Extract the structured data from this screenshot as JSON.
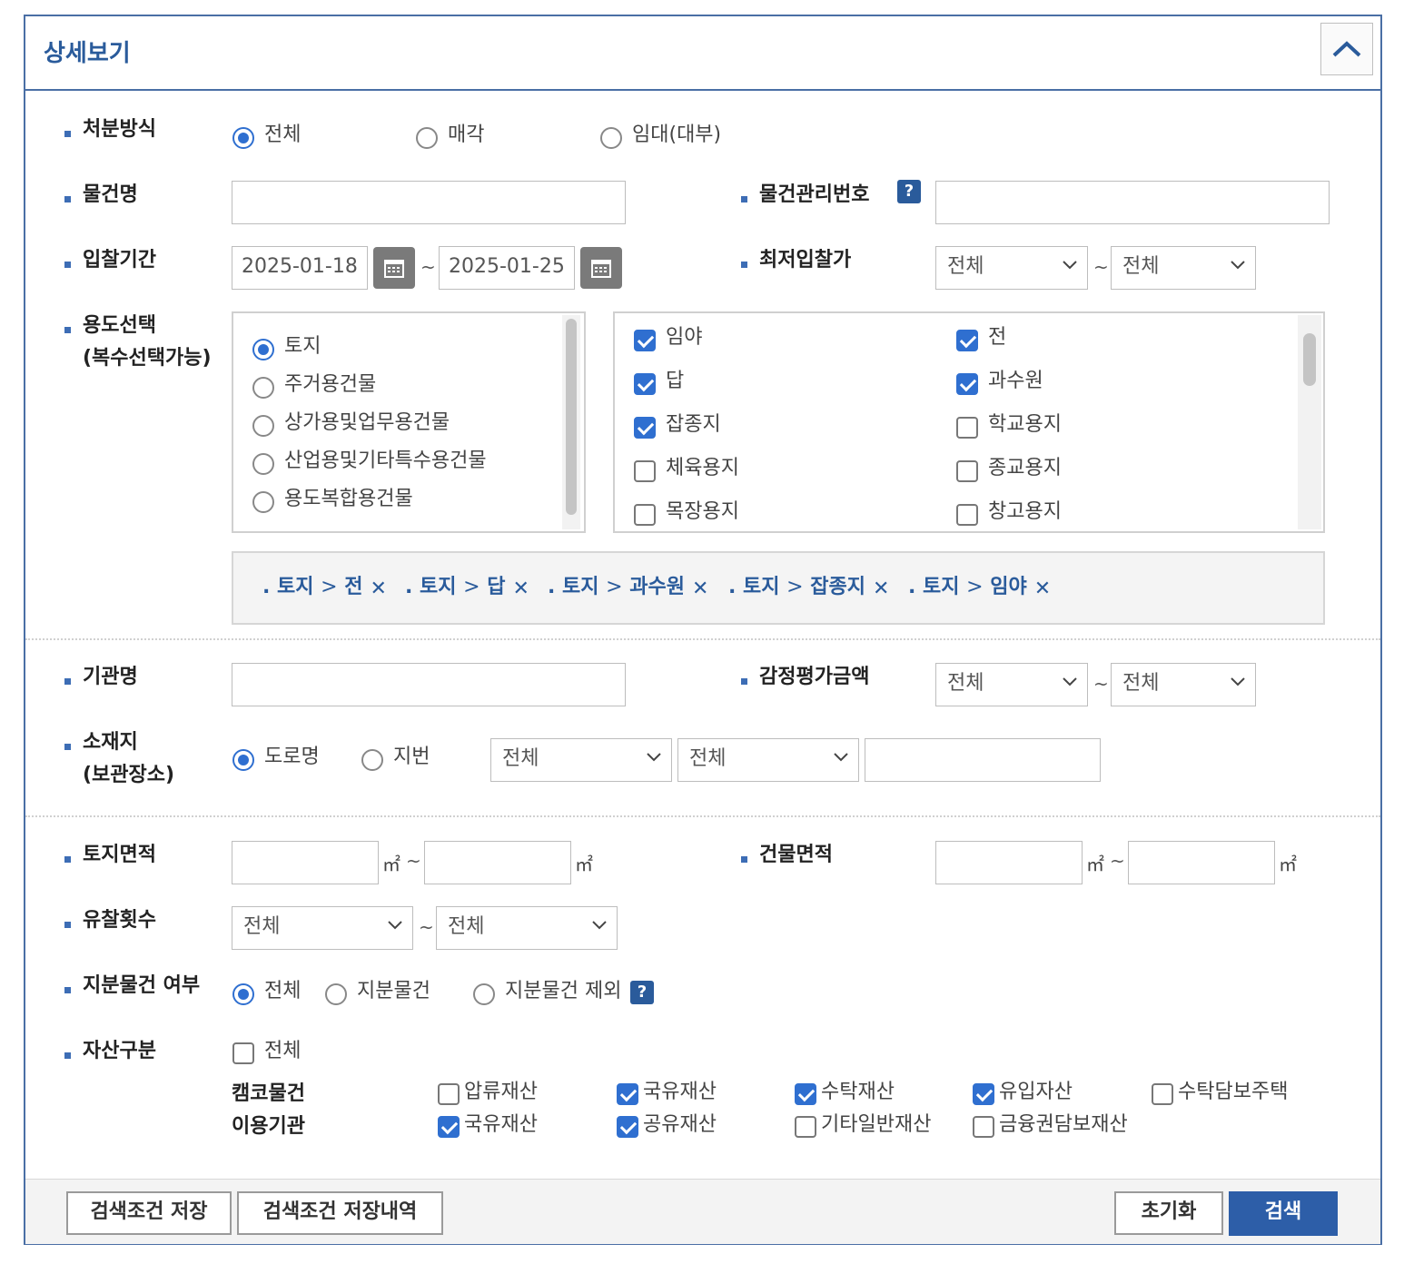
{
  "header": {
    "title": "상세보기",
    "collapse_icon": "chevron-up-icon"
  },
  "disposal": {
    "label": "처분방식",
    "options": [
      "전체",
      "매각",
      "임대(대부)"
    ],
    "selected": "전체"
  },
  "item_name": {
    "label": "물건명",
    "value": ""
  },
  "item_mgmt_no": {
    "label": "물건관리번호",
    "help": "?",
    "value": ""
  },
  "bid_period": {
    "label": "입찰기간",
    "start": "2025-01-18",
    "end": "2025-01-25",
    "tilde": "~"
  },
  "min_bid_price": {
    "label": "최저입찰가",
    "from": "전체",
    "to": "전체",
    "tilde": "~"
  },
  "usage": {
    "label_line1": "용도선택",
    "label_line2": "(복수선택가능)",
    "categories": [
      "토지",
      "주거용건물",
      "상가용및업무용건물",
      "산업용및기타특수용건물",
      "용도복합용건물"
    ],
    "selected_category": "토지",
    "subtypes": [
      {
        "name": "임야",
        "checked": true
      },
      {
        "name": "전",
        "checked": true
      },
      {
        "name": "답",
        "checked": true
      },
      {
        "name": "과수원",
        "checked": true
      },
      {
        "name": "잡종지",
        "checked": true
      },
      {
        "name": "학교용지",
        "checked": false
      },
      {
        "name": "체육용지",
        "checked": false
      },
      {
        "name": "종교용지",
        "checked": false
      },
      {
        "name": "목장용지",
        "checked": false
      },
      {
        "name": "창고용지",
        "checked": false
      }
    ],
    "tags": [
      {
        "prefix": ". 토지",
        "sep": ">",
        "item": "전"
      },
      {
        "prefix": ". 토지",
        "sep": ">",
        "item": "답"
      },
      {
        "prefix": ". 토지",
        "sep": ">",
        "item": "과수원"
      },
      {
        "prefix": ". 토지",
        "sep": ">",
        "item": "잡종지"
      },
      {
        "prefix": ". 토지",
        "sep": ">",
        "item": "임야"
      }
    ]
  },
  "agency": {
    "label": "기관명",
    "value": ""
  },
  "appraisal": {
    "label": "감정평가금액",
    "from": "전체",
    "to": "전체",
    "tilde": "~"
  },
  "location": {
    "label_line1": "소재지",
    "label_line2": "(보관장소)",
    "options": [
      "도로명",
      "지번"
    ],
    "selected": "도로명",
    "select1": "전체",
    "select2": "전체",
    "detail": ""
  },
  "land_area": {
    "label": "토지면적",
    "unit": "㎡",
    "tilde": "~"
  },
  "building_area": {
    "label": "건물면적",
    "unit": "㎡",
    "tilde": "~"
  },
  "failed_bids": {
    "label": "유찰횟수",
    "from": "전체",
    "to": "전체",
    "tilde": "~"
  },
  "share": {
    "label": "지분물건 여부",
    "options": [
      "전체",
      "지분물건",
      "지분물건 제외"
    ],
    "selected": "전체",
    "help": "?"
  },
  "asset": {
    "label": "자산구분",
    "all": {
      "name": "전체",
      "checked": false
    },
    "row1_label": "캠코물건",
    "row1": [
      {
        "name": "압류재산",
        "checked": false
      },
      {
        "name": "국유재산",
        "checked": true
      },
      {
        "name": "수탁재산",
        "checked": true
      },
      {
        "name": "유입자산",
        "checked": true
      },
      {
        "name": "수탁담보주택",
        "checked": false
      }
    ],
    "row2_label": "이용기관",
    "row2": [
      {
        "name": "국유재산",
        "checked": true
      },
      {
        "name": "공유재산",
        "checked": true
      },
      {
        "name": "기타일반재산",
        "checked": false
      },
      {
        "name": "금융권담보재산",
        "checked": false
      }
    ]
  },
  "footer": {
    "save_label": "검색조건 저장",
    "history_label": "검색조건 저장내역",
    "reset_label": "초기화",
    "search_label": "검색"
  },
  "colors": {
    "accent": "#2d5ea8",
    "title": "#2a5b9b",
    "border": "#4a6fa5"
  }
}
